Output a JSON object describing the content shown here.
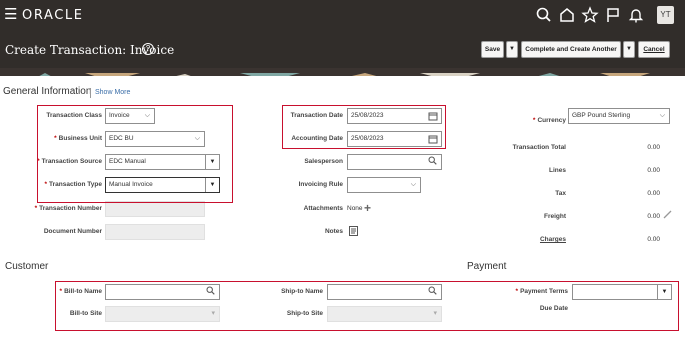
{
  "navbar": {
    "menu_icon": "☰",
    "brand": "ORACLE",
    "avatar": "YT",
    "icons": [
      "search-icon",
      "home-icon",
      "star-icon",
      "flag-icon",
      "bell-icon"
    ]
  },
  "header": {
    "title": "Create Transaction: Invoice",
    "help": "?",
    "save": "Save",
    "complete": "Complete and Create Another",
    "cancel": "Cancel",
    "arrow": "▼"
  },
  "general": {
    "heading": "General Information",
    "show_more": "Show More",
    "transaction_class": {
      "label": "Transaction Class",
      "value": "Invoice"
    },
    "business_unit": {
      "label": "Business Unit",
      "value": "EDC BU"
    },
    "transaction_source": {
      "label": "Transaction Source",
      "value": "EDC Manual"
    },
    "transaction_type": {
      "label": "Transaction Type",
      "value": "Manual Invoice"
    },
    "transaction_number": {
      "label": "Transaction Number",
      "value": ""
    },
    "document_number": {
      "label": "Document Number",
      "value": ""
    },
    "transaction_date": {
      "label": "Transaction Date",
      "value": "25/08/2023"
    },
    "accounting_date": {
      "label": "Accounting Date",
      "value": "25/08/2023"
    },
    "salesperson": {
      "label": "Salesperson",
      "value": ""
    },
    "invoicing_rule": {
      "label": "Invoicing Rule",
      "value": ""
    },
    "attachments": {
      "label": "Attachments",
      "value": "None"
    },
    "notes": {
      "label": "Notes"
    },
    "currency": {
      "label": "Currency",
      "value": "GBP Pound Sterling"
    },
    "transaction_total": {
      "label": "Transaction Total",
      "value": "0.00"
    },
    "lines": {
      "label": "Lines",
      "value": "0.00"
    },
    "tax": {
      "label": "Tax",
      "value": "0.00"
    },
    "freight": {
      "label": "Freight",
      "value": "0.00"
    },
    "charges": {
      "label": "Charges",
      "value": "0.00"
    }
  },
  "customer": {
    "heading": "Customer",
    "bill_to_name": {
      "label": "Bill-to Name",
      "value": ""
    },
    "bill_to_site": {
      "label": "Bill-to Site",
      "value": ""
    },
    "ship_to_name": {
      "label": "Ship-to Name",
      "value": ""
    },
    "ship_to_site": {
      "label": "Ship-to Site",
      "value": ""
    }
  },
  "payment": {
    "heading": "Payment",
    "payment_terms": {
      "label": "Payment Terms",
      "value": ""
    },
    "due_date": {
      "label": "Due Date",
      "value": ""
    }
  },
  "colors": {
    "header_bg": "#312d2a",
    "highlight": "#c8102e",
    "link": "#3b6ea8",
    "required": "#b00000"
  }
}
